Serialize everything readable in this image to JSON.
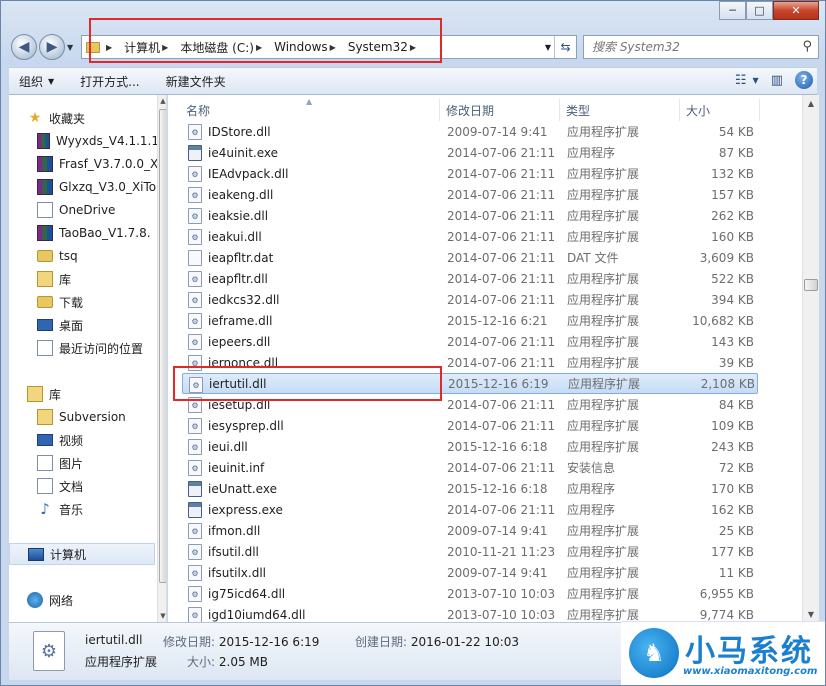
{
  "window": {
    "min_glyph": "─",
    "max_glyph": "□",
    "close_glyph": "✕"
  },
  "nav": {
    "back_glyph": "◀",
    "forward_glyph": "▶",
    "breadcrumb": [
      "计算机",
      "本地磁盘 (C:)",
      "Windows",
      "System32"
    ],
    "search_placeholder": "搜索 System32"
  },
  "toolbar": {
    "organize": "组织",
    "open_with": "打开方式...",
    "new_folder": "新建文件夹"
  },
  "sidebar": {
    "favorites_header": "收藏夹",
    "favorites": [
      {
        "label": "Wyyxds_V4.1.1.1",
        "icon": "rar-archive-icon"
      },
      {
        "label": "Frasf_V3.7.0.0_X",
        "icon": "rar-archive-icon"
      },
      {
        "label": "Glxzq_V3.0_XiTo",
        "icon": "rar-archive-icon"
      },
      {
        "label": "OneDrive",
        "icon": "onedrive-icon"
      },
      {
        "label": "TaoBao_V1.7.8.",
        "icon": "rar-archive-icon"
      },
      {
        "label": "tsq",
        "icon": "folder-icon"
      },
      {
        "label": "库",
        "icon": "library-icon"
      },
      {
        "label": "下载",
        "icon": "downloads-folder-icon"
      },
      {
        "label": "桌面",
        "icon": "desktop-icon"
      },
      {
        "label": "最近访问的位置",
        "icon": "recent-places-icon"
      }
    ],
    "libraries_header": "库",
    "libraries": [
      {
        "label": "Subversion",
        "icon": "library-icon"
      },
      {
        "label": "视频",
        "icon": "videos-library-icon"
      },
      {
        "label": "图片",
        "icon": "pictures-library-icon"
      },
      {
        "label": "文档",
        "icon": "documents-library-icon"
      },
      {
        "label": "音乐",
        "icon": "music-library-icon"
      }
    ],
    "computer": "计算机",
    "network": "网络"
  },
  "columns": {
    "name": "名称",
    "date": "修改日期",
    "type": "类型",
    "size": "大小"
  },
  "files": [
    {
      "name": "IDStore.dll",
      "date": "2009-07-14 9:41",
      "type": "应用程序扩展",
      "size": "54 KB",
      "kind": "dll"
    },
    {
      "name": "ie4uinit.exe",
      "date": "2014-07-06 21:11",
      "type": "应用程序",
      "size": "87 KB",
      "kind": "exe"
    },
    {
      "name": "IEAdvpack.dll",
      "date": "2014-07-06 21:11",
      "type": "应用程序扩展",
      "size": "132 KB",
      "kind": "dll"
    },
    {
      "name": "ieakeng.dll",
      "date": "2014-07-06 21:11",
      "type": "应用程序扩展",
      "size": "157 KB",
      "kind": "dll"
    },
    {
      "name": "ieaksie.dll",
      "date": "2014-07-06 21:11",
      "type": "应用程序扩展",
      "size": "262 KB",
      "kind": "dll"
    },
    {
      "name": "ieakui.dll",
      "date": "2014-07-06 21:11",
      "type": "应用程序扩展",
      "size": "160 KB",
      "kind": "dll"
    },
    {
      "name": "ieapfltr.dat",
      "date": "2014-07-06 21:11",
      "type": "DAT 文件",
      "size": "3,609 KB",
      "kind": "dat"
    },
    {
      "name": "ieapfltr.dll",
      "date": "2014-07-06 21:11",
      "type": "应用程序扩展",
      "size": "522 KB",
      "kind": "dll"
    },
    {
      "name": "iedkcs32.dll",
      "date": "2014-07-06 21:11",
      "type": "应用程序扩展",
      "size": "394 KB",
      "kind": "dll"
    },
    {
      "name": "ieframe.dll",
      "date": "2015-12-16 6:21",
      "type": "应用程序扩展",
      "size": "10,682 KB",
      "kind": "dll"
    },
    {
      "name": "iepeers.dll",
      "date": "2014-07-06 21:11",
      "type": "应用程序扩展",
      "size": "143 KB",
      "kind": "dll"
    },
    {
      "name": "iernonce.dll",
      "date": "2014-07-06 21:11",
      "type": "应用程序扩展",
      "size": "39 KB",
      "kind": "dll"
    },
    {
      "name": "iertutil.dll",
      "date": "2015-12-16 6:19",
      "type": "应用程序扩展",
      "size": "2,108 KB",
      "kind": "dll",
      "selected": true
    },
    {
      "name": "iesetup.dll",
      "date": "2014-07-06 21:11",
      "type": "应用程序扩展",
      "size": "84 KB",
      "kind": "dll"
    },
    {
      "name": "iesysprep.dll",
      "date": "2014-07-06 21:11",
      "type": "应用程序扩展",
      "size": "109 KB",
      "kind": "dll"
    },
    {
      "name": "ieui.dll",
      "date": "2015-12-16 6:18",
      "type": "应用程序扩展",
      "size": "243 KB",
      "kind": "dll"
    },
    {
      "name": "ieuinit.inf",
      "date": "2014-07-06 21:11",
      "type": "安装信息",
      "size": "72 KB",
      "kind": "inf"
    },
    {
      "name": "ieUnatt.exe",
      "date": "2015-12-16 6:18",
      "type": "应用程序",
      "size": "170 KB",
      "kind": "exe"
    },
    {
      "name": "iexpress.exe",
      "date": "2014-07-06 21:11",
      "type": "应用程序",
      "size": "162 KB",
      "kind": "exe"
    },
    {
      "name": "ifmon.dll",
      "date": "2009-07-14 9:41",
      "type": "应用程序扩展",
      "size": "25 KB",
      "kind": "dll"
    },
    {
      "name": "ifsutil.dll",
      "date": "2010-11-21 11:23",
      "type": "应用程序扩展",
      "size": "177 KB",
      "kind": "dll"
    },
    {
      "name": "ifsutilx.dll",
      "date": "2009-07-14 9:41",
      "type": "应用程序扩展",
      "size": "11 KB",
      "kind": "dll"
    },
    {
      "name": "ig75icd64.dll",
      "date": "2013-07-10 10:03",
      "type": "应用程序扩展",
      "size": "6,955 KB",
      "kind": "dll"
    },
    {
      "name": "igd10iumd64.dll",
      "date": "2013-07-10 10:03",
      "type": "应用程序扩展",
      "size": "9,774 KB",
      "kind": "dll"
    }
  ],
  "details": {
    "filename": "iertutil.dll",
    "filetype": "应用程序扩展",
    "modified_label": "修改日期:",
    "modified_value": "2015-12-16 6:19",
    "created_label": "创建日期:",
    "created_value": "2016-01-22 10:03",
    "size_label": "大小:",
    "size_value": "2.05 MB"
  },
  "watermark": {
    "brand": "小马系统",
    "url": "www.xiaomaxitong.com"
  },
  "colors": {
    "highlight_box": "#e02a2a",
    "selection_fill": "#cfe2f8",
    "brand_blue": "#1b7fd0"
  }
}
